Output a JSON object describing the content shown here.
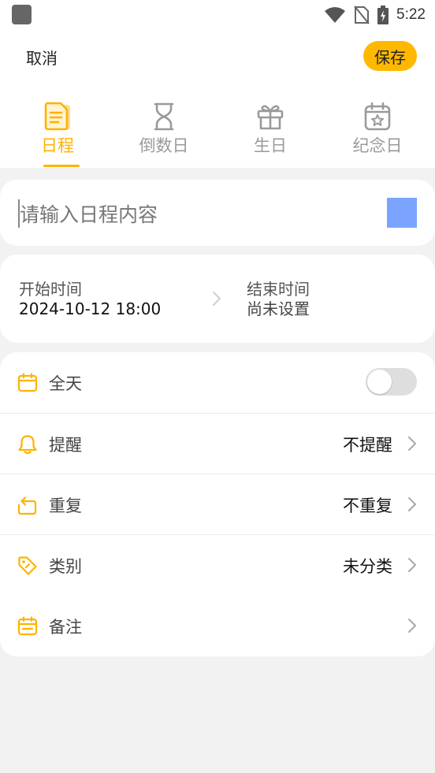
{
  "status_bar": {
    "time": "5:22"
  },
  "header": {
    "cancel_label": "取消",
    "save_label": "保存"
  },
  "tabs": [
    {
      "label": "日程",
      "icon": "document-icon",
      "active": true
    },
    {
      "label": "倒数日",
      "icon": "hourglass-icon",
      "active": false
    },
    {
      "label": "生日",
      "icon": "gift-icon",
      "active": false
    },
    {
      "label": "纪念日",
      "icon": "calendar-star-icon",
      "active": false
    }
  ],
  "content_input": {
    "placeholder": "请输入日程内容",
    "value": "",
    "color": "#7ba4ff"
  },
  "time": {
    "start_label": "开始时间",
    "start_value": "2024-10-12 18:00",
    "end_label": "结束时间",
    "end_value": "尚未设置"
  },
  "settings": [
    {
      "label": "全天",
      "icon": "calendar-icon",
      "value": "",
      "control": "toggle",
      "toggle_on": false
    },
    {
      "label": "提醒",
      "icon": "bell-icon",
      "value": "不提醒",
      "control": "chevron"
    },
    {
      "label": "重复",
      "icon": "repeat-icon",
      "value": "不重复",
      "control": "chevron"
    },
    {
      "label": "类别",
      "icon": "tag-icon",
      "value": "未分类",
      "control": "chevron"
    },
    {
      "label": "备注",
      "icon": "note-icon",
      "value": "",
      "control": "chevron"
    }
  ],
  "colors": {
    "accent": "#ffb200",
    "save_button": "#ffb800",
    "inactive": "#9a9a9a",
    "background": "#f2f2f2"
  }
}
